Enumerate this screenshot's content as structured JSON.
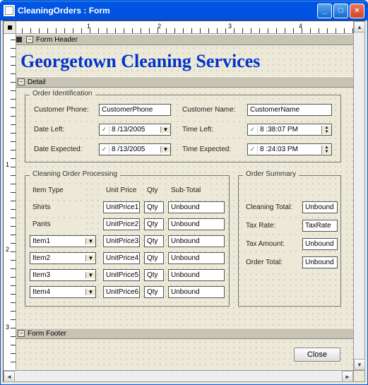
{
  "window": {
    "title": "CleaningOrders : Form"
  },
  "ruler_h": [
    "1",
    "2",
    "3",
    "4"
  ],
  "ruler_v": [
    "1",
    "2",
    "3"
  ],
  "sections": {
    "header": "Form Header",
    "detail": "Detail",
    "footer": "Form Footer"
  },
  "title": "Georgetown Cleaning Services",
  "groups": {
    "identification": "Order Identification",
    "processing": "Cleaning Order Processing",
    "summary": "Order Summary"
  },
  "id_fields": {
    "customer_phone": {
      "label": "Customer Phone:",
      "value": "CustomerPhone"
    },
    "customer_name": {
      "label": "Customer Name:",
      "value": "CustomerName"
    },
    "date_left": {
      "label": "Date Left:",
      "value": "8 /13/2005"
    },
    "time_left": {
      "label": "Time Left:",
      "value": "8 :38:07 PM"
    },
    "date_expected": {
      "label": "Date Expected:",
      "value": "8 /13/2005"
    },
    "time_expected": {
      "label": "Time Expected:",
      "value": "8 :24:03 PM"
    }
  },
  "processing": {
    "headers": {
      "item": "Item Type",
      "price": "Unit Price",
      "qty": "Qty",
      "subtotal": "Sub-Total"
    },
    "rows": [
      {
        "item": "Shirts",
        "combo": false,
        "price": "UnitPrice1",
        "qty": "Qty",
        "subtotal": "Unbound"
      },
      {
        "item": "Pants",
        "combo": false,
        "price": "UnitPrice2",
        "qty": "Qty",
        "subtotal": "Unbound"
      },
      {
        "item": "Item1",
        "combo": true,
        "price": "UnitPrice3",
        "qty": "Qty",
        "subtotal": "Unbound"
      },
      {
        "item": "Item2",
        "combo": true,
        "price": "UnitPrice4",
        "qty": "Qty",
        "subtotal": "Unbound"
      },
      {
        "item": "Item3",
        "combo": true,
        "price": "UnitPrice5",
        "qty": "Qty",
        "subtotal": "Unbound"
      },
      {
        "item": "Item4",
        "combo": true,
        "price": "UnitPrice6",
        "qty": "Qty",
        "subtotal": "Unbound"
      }
    ]
  },
  "summary": {
    "cleaning_total": {
      "label": "Cleaning Total:",
      "value": "Unbound"
    },
    "tax_rate": {
      "label": "Tax Rate:",
      "value": "TaxRate"
    },
    "tax_amount": {
      "label": "Tax Amount:",
      "value": "Unbound"
    },
    "order_total": {
      "label": "Order Total:",
      "value": "Unbound"
    }
  },
  "footer": {
    "close": "Close"
  }
}
